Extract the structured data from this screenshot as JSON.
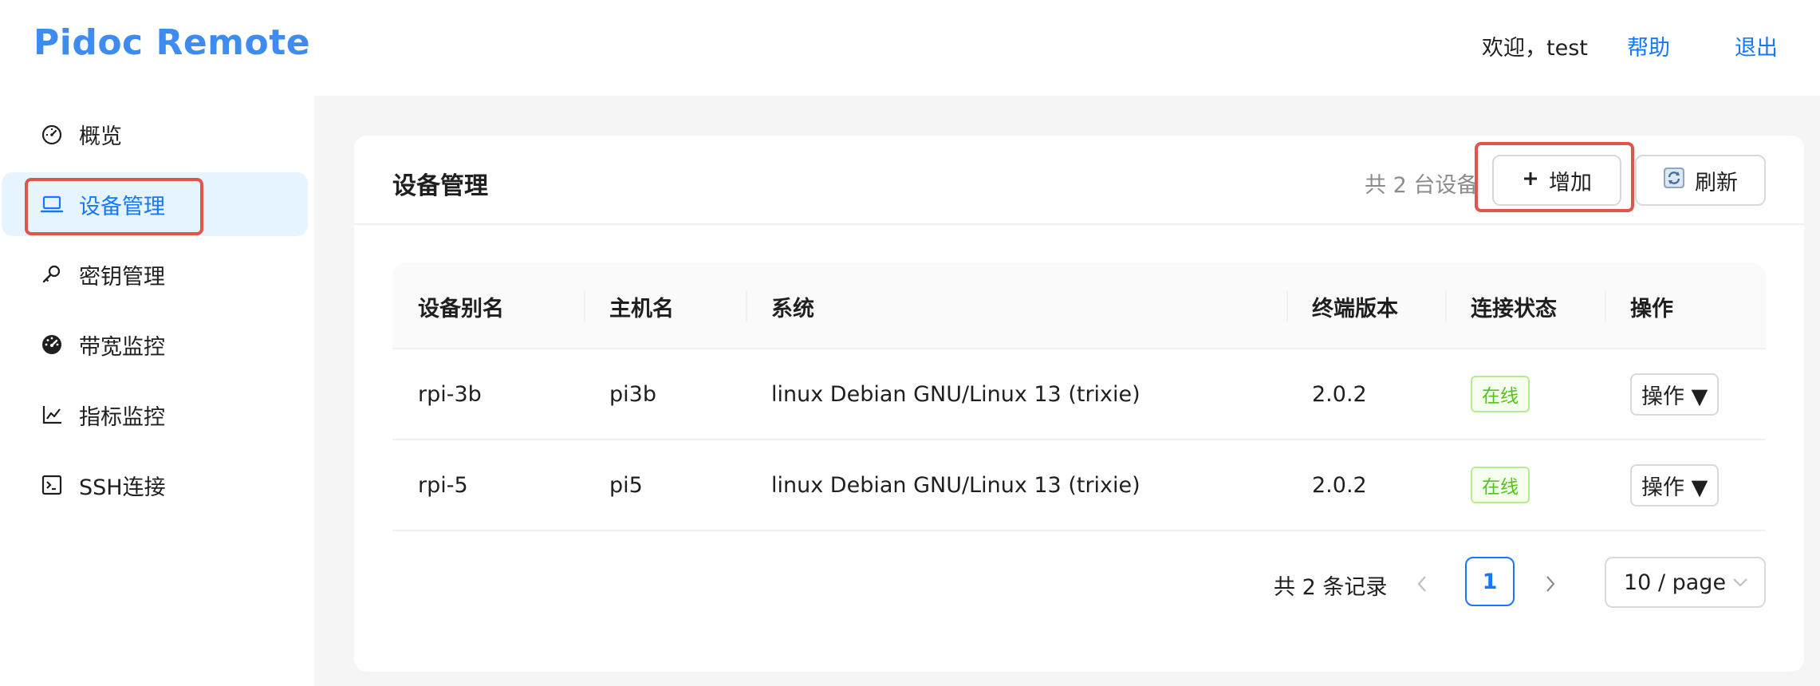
{
  "header": {
    "logo": "Pidoc Remote",
    "welcome": "欢迎，test",
    "help": "帮助",
    "logout": "退出"
  },
  "sidebar": {
    "items": [
      {
        "label": "概览",
        "icon": "dashboard-icon"
      },
      {
        "label": "设备管理",
        "icon": "laptop-icon",
        "active": true
      },
      {
        "label": "密钥管理",
        "icon": "key-icon"
      },
      {
        "label": "带宽监控",
        "icon": "gauge-icon"
      },
      {
        "label": "指标监控",
        "icon": "line-chart-icon"
      },
      {
        "label": "SSH连接",
        "icon": "terminal-icon"
      }
    ]
  },
  "card": {
    "title": "设备管理",
    "count_text": "共 2 台设备",
    "add_label": "增加",
    "refresh_label": "刷新"
  },
  "table": {
    "columns": [
      "设备别名",
      "主机名",
      "系统",
      "终端版本",
      "连接状态",
      "操作"
    ],
    "rows": [
      {
        "alias": "rpi-3b",
        "hostname": "pi3b",
        "system": "linux Debian GNU/Linux 13 (trixie)",
        "version": "2.0.2",
        "status": "在线",
        "action": "操作 ▼"
      },
      {
        "alias": "rpi-5",
        "hostname": "pi5",
        "system": "linux Debian GNU/Linux 13 (trixie)",
        "version": "2.0.2",
        "status": "在线",
        "action": "操作 ▼"
      }
    ]
  },
  "pagination": {
    "total_text": "共 2 条记录",
    "current_page": "1",
    "page_size": "10 / page"
  },
  "colors": {
    "brand": "#3f8cf0",
    "link": "#1677ff",
    "highlight_box": "#e0544a",
    "status_online": "#52c41a"
  }
}
